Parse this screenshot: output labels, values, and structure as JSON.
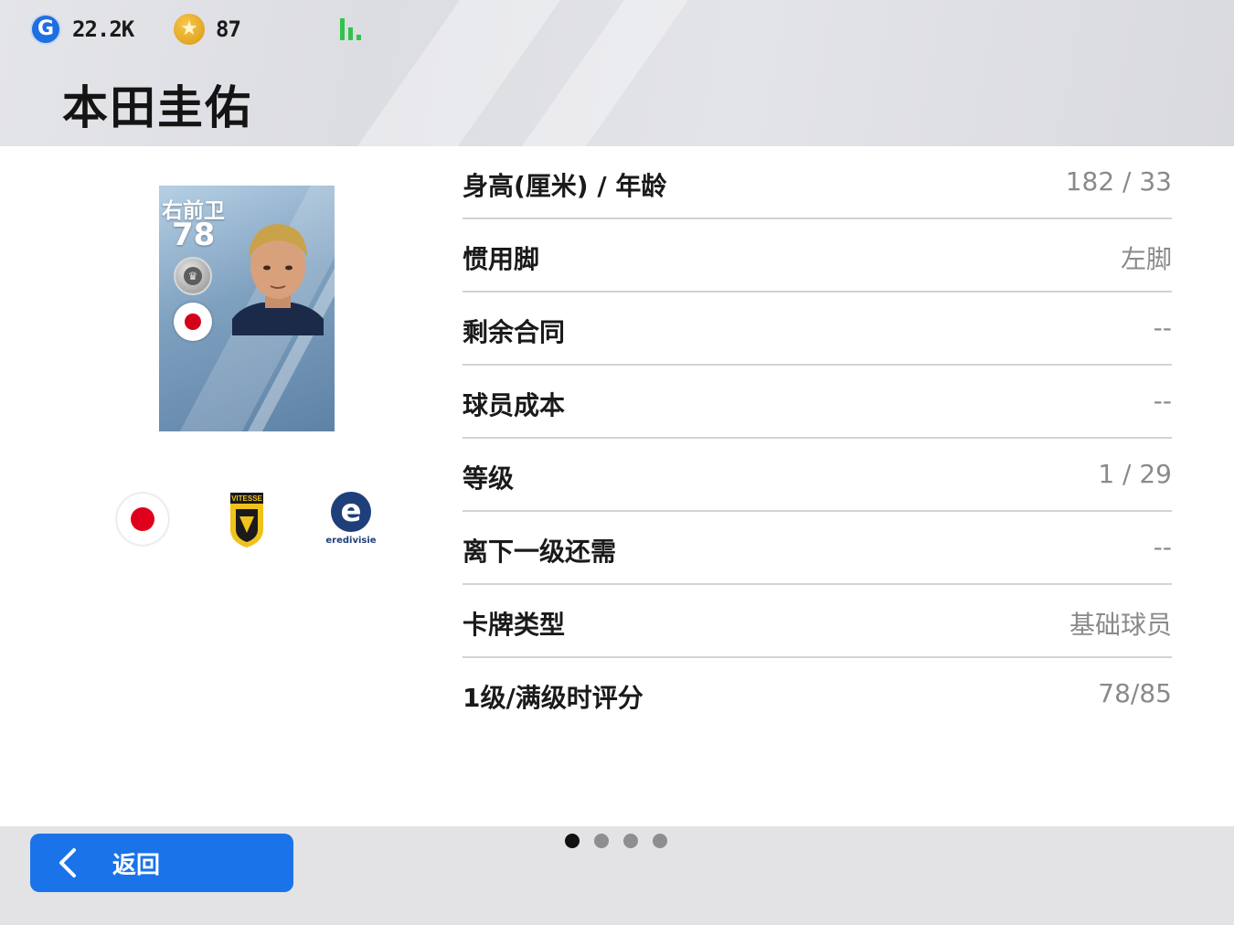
{
  "header": {
    "gp": {
      "icon": "gp-coin-icon",
      "letter": "G",
      "value": "22.2K"
    },
    "coins": {
      "icon": "star-coin-icon",
      "glyph": "★",
      "value": "87"
    },
    "signal_icon": "signal-bars-icon",
    "player_name": "本田圭佑"
  },
  "card": {
    "position": "右前卫",
    "rating": "78",
    "badge_icon": "silver-club-badge-icon",
    "flag_icon": "japan-flag-icon",
    "portrait_icon": "player-portrait"
  },
  "badges": {
    "nation_icon": "japan-flag-icon",
    "club_icon": "vitesse-crest-icon",
    "club_name": "VITESSE",
    "league_icon": "eredivisie-logo-icon",
    "league_letter": "e",
    "league_name": "eredivisie"
  },
  "attributes": [
    {
      "label": "身高(厘米) / 年龄",
      "value": "182 / 33"
    },
    {
      "label": "惯用脚",
      "value": "左脚"
    },
    {
      "label": "剩余合同",
      "value": "--"
    },
    {
      "label": "球员成本",
      "value": "--"
    },
    {
      "label": "等级",
      "value": "1 / 29"
    },
    {
      "label": "离下一级还需",
      "value": "--"
    },
    {
      "label": "卡牌类型",
      "value": "基础球员"
    },
    {
      "label": "1级/满级时评分",
      "value": "78/85"
    }
  ],
  "footer": {
    "back_label": "返回",
    "back_icon": "chevron-left-icon",
    "pages": 4,
    "active_page": 1
  },
  "colors": {
    "accent": "#1a73e8",
    "signal": "#35c24a",
    "flag_red": "#e0001b"
  }
}
